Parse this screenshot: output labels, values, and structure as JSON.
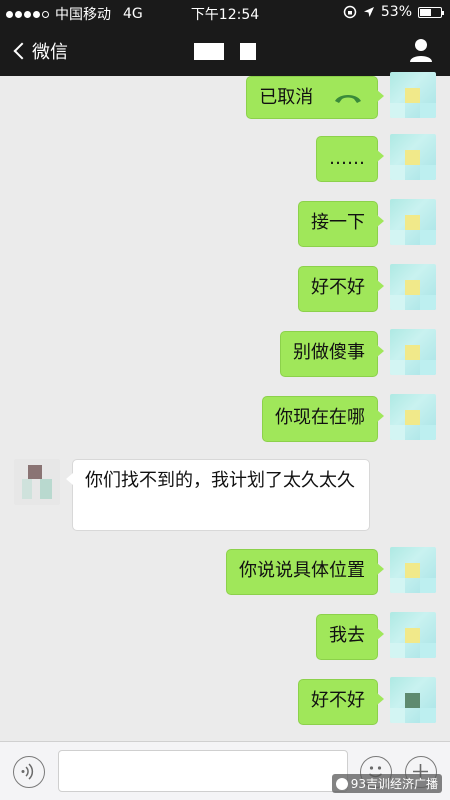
{
  "status_bar": {
    "carrier": "中国移动",
    "network": "4G",
    "time": "下午12:54",
    "battery_text": "53%",
    "battery_level": 0.53
  },
  "nav": {
    "back_label": "微信",
    "back_icon": "chevron-left-icon",
    "profile_icon": "person-icon"
  },
  "messages": [
    {
      "side": "me",
      "text": "已取消",
      "icon": "phone-hangup-icon"
    },
    {
      "side": "me",
      "text": "……"
    },
    {
      "side": "me",
      "text": "接一下"
    },
    {
      "side": "me",
      "text": "好不好"
    },
    {
      "side": "me",
      "text": "别做傻事"
    },
    {
      "side": "me",
      "text": "你现在在哪"
    },
    {
      "side": "other",
      "text": "你们找不到的，我计划了太久太久"
    },
    {
      "side": "me",
      "text": "你说说具体位置"
    },
    {
      "side": "me",
      "text": "我去"
    },
    {
      "side": "me",
      "text": "好不好"
    }
  ],
  "input_bar": {
    "voice_icon": "voice-icon",
    "emoji_icon": "emoji-icon",
    "plus_icon": "plus-icon",
    "watermark": "93吉训经济广播"
  },
  "colors": {
    "bar_bg": "#1a1a1a",
    "chat_bg": "#ebebeb",
    "bubble_me": "#a0e75a",
    "bubble_other": "#ffffff",
    "phone_icon": "#3a8a3a"
  }
}
